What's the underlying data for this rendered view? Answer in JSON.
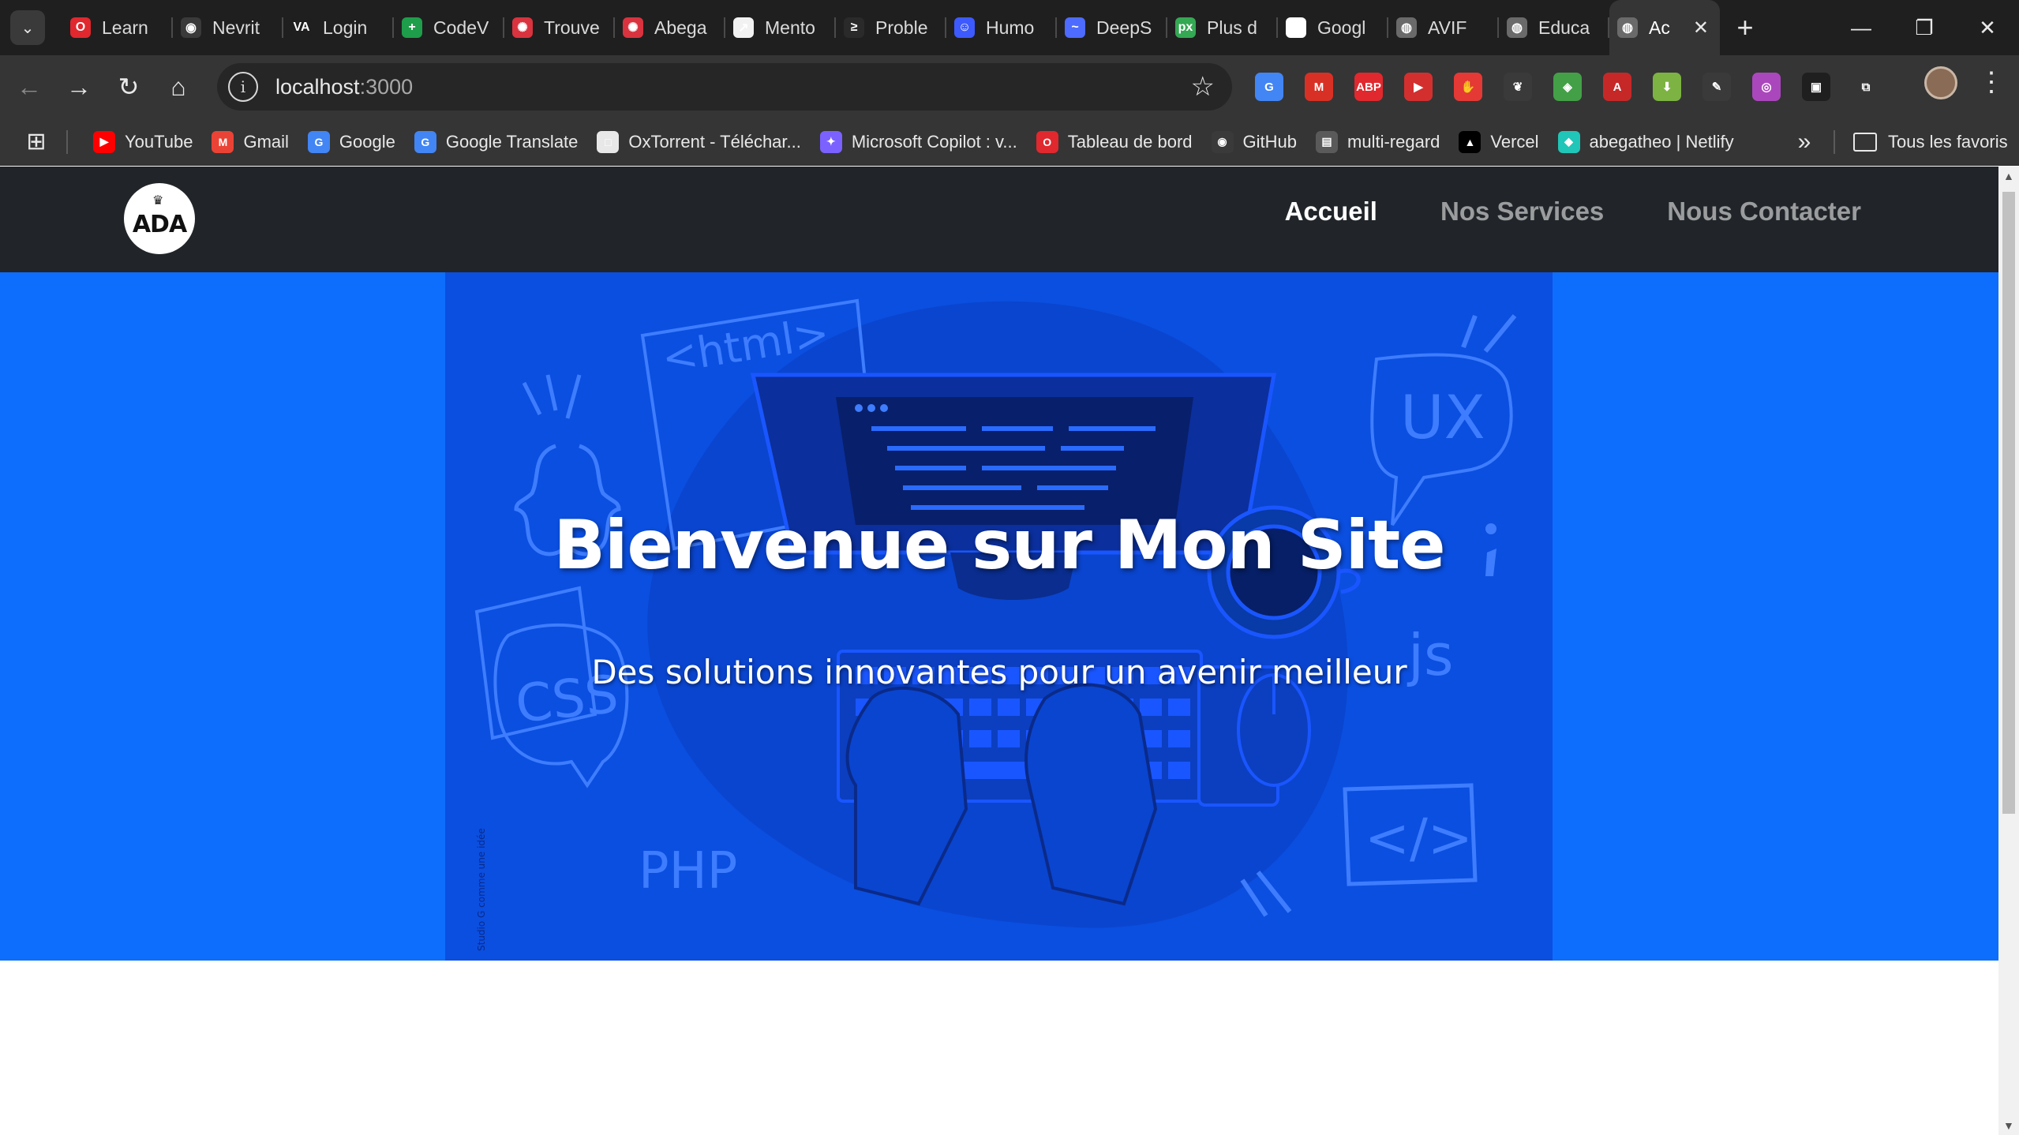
{
  "browser": {
    "tabs": [
      {
        "title": "Learn",
        "favicon": "opera-red-icon",
        "color": "#e0282e",
        "glyph": "O"
      },
      {
        "title": "Nevrit",
        "favicon": "github-icon",
        "color": "#3a3a3a",
        "glyph": "◉"
      },
      {
        "title": "Login",
        "favicon": "va-logo-icon",
        "color": "#1f1f1f",
        "glyph": "VA"
      },
      {
        "title": "CodeV",
        "favicon": "plus-green-icon",
        "color": "#1e9e4a",
        "glyph": "+"
      },
      {
        "title": "Trouve",
        "favicon": "openai-red-icon",
        "color": "#d9333f",
        "glyph": "✺"
      },
      {
        "title": "Abega",
        "favicon": "openai-red-icon",
        "color": "#d9333f",
        "glyph": "✺"
      },
      {
        "title": "Mento",
        "favicon": "mentor-icon",
        "color": "#f2f2f2",
        "glyph": "↗"
      },
      {
        "title": "Proble",
        "favicon": "codeforces-icon",
        "color": "#2a2a2a",
        "glyph": "≥"
      },
      {
        "title": "Humo",
        "favicon": "humor-icon",
        "color": "#3d5afe",
        "glyph": "☺"
      },
      {
        "title": "DeepS",
        "favicon": "deepseek-icon",
        "color": "#4d6bfe",
        "glyph": "~"
      },
      {
        "title": "Plus d",
        "favicon": "px-icon",
        "color": "#34a853",
        "glyph": "px"
      },
      {
        "title": "Googl",
        "favicon": "google-icon",
        "color": "#ffffff",
        "glyph": "G"
      },
      {
        "title": "AVIF",
        "favicon": "globe-icon",
        "color": "#6a6a6a",
        "glyph": "◍"
      },
      {
        "title": "Educa",
        "favicon": "globe-icon",
        "color": "#6a6a6a",
        "glyph": "◍"
      },
      {
        "title": "Ac",
        "favicon": "globe-icon",
        "color": "#6a6a6a",
        "glyph": "◍",
        "active": true
      }
    ],
    "url_host": "localhost",
    "url_port": ":3000",
    "bookmarks": [
      {
        "label": "YouTube",
        "icon": "youtube-icon",
        "color": "#ff0000",
        "glyph": "▶"
      },
      {
        "label": "Gmail",
        "icon": "gmail-icon",
        "color": "#ea4335",
        "glyph": "M"
      },
      {
        "label": "Google",
        "icon": "google-icon",
        "color": "#4285f4",
        "glyph": "G"
      },
      {
        "label": "Google Translate",
        "icon": "translate-icon",
        "color": "#4285f4",
        "glyph": "G"
      },
      {
        "label": "OxTorrent - Téléchar...",
        "icon": "square-icon",
        "color": "#e8e8e8",
        "glyph": "□"
      },
      {
        "label": "Microsoft Copilot : v...",
        "icon": "copilot-icon",
        "color": "#7b61ff",
        "glyph": "✦"
      },
      {
        "label": "Tableau de bord",
        "icon": "opera-red-icon",
        "color": "#e0282e",
        "glyph": "O"
      },
      {
        "label": "GitHub",
        "icon": "github-icon",
        "color": "#3a3a3a",
        "glyph": "◉"
      },
      {
        "label": "multi-regard",
        "icon": "document-icon",
        "color": "#5a5a5a",
        "glyph": "▤"
      },
      {
        "label": "Vercel",
        "icon": "vercel-icon",
        "color": "#000000",
        "glyph": "▲"
      },
      {
        "label": "abegatheo | Netlify",
        "icon": "netlify-icon",
        "color": "#20c6b7",
        "glyph": "◆"
      }
    ],
    "all_bookmarks_label": "Tous les favoris",
    "extensions": [
      {
        "name": "translate-ext-icon",
        "color": "#4285f4",
        "glyph": "G"
      },
      {
        "name": "gmail-ext-icon",
        "color": "#d93025",
        "glyph": "M"
      },
      {
        "name": "adblock-plus-icon",
        "color": "#e0282e",
        "glyph": "ABP"
      },
      {
        "name": "video-ext-icon",
        "color": "#d32f2f",
        "glyph": "▶"
      },
      {
        "name": "hand-stop-icon",
        "color": "#e53935",
        "glyph": "✋"
      },
      {
        "name": "gnome-ext-icon",
        "color": "#3a3a3a",
        "glyph": "❦"
      },
      {
        "name": "colorful-ext-icon",
        "color": "#43a047",
        "glyph": "◈"
      },
      {
        "name": "pdf-ext-icon",
        "color": "#c62828",
        "glyph": "A"
      },
      {
        "name": "download-ext-icon",
        "color": "#7cb342",
        "glyph": "⬇"
      },
      {
        "name": "eyedropper-icon",
        "color": "#3a3a3a",
        "glyph": "✎"
      },
      {
        "name": "color-wheel-icon",
        "color": "#ab47bc",
        "glyph": "◎"
      },
      {
        "name": "tab-ext-icon",
        "color": "#1f1f1f",
        "glyph": "▣"
      },
      {
        "name": "extensions-puzzle-icon",
        "color": "#353535",
        "glyph": "⧉"
      }
    ]
  },
  "site": {
    "logo_text": "ADA",
    "nav": [
      {
        "label": "Accueil",
        "current": true
      },
      {
        "label": "Nos Services",
        "current": false
      },
      {
        "label": "Nous Contacter",
        "current": false
      }
    ],
    "hero": {
      "title": "Bienvenue sur Mon Site",
      "subtitle": "Des solutions innovantes pour un avenir meilleur",
      "illustration": {
        "code_labels": [
          "<html>",
          "UX",
          "CSS",
          "js",
          "PHP",
          "</>"
        ],
        "credit": "Studio G comme une idée"
      }
    }
  },
  "colors": {
    "hero_bg": "#0d6efd",
    "hero_image_bg": "#0b4fe0",
    "header_bg": "#212529"
  }
}
